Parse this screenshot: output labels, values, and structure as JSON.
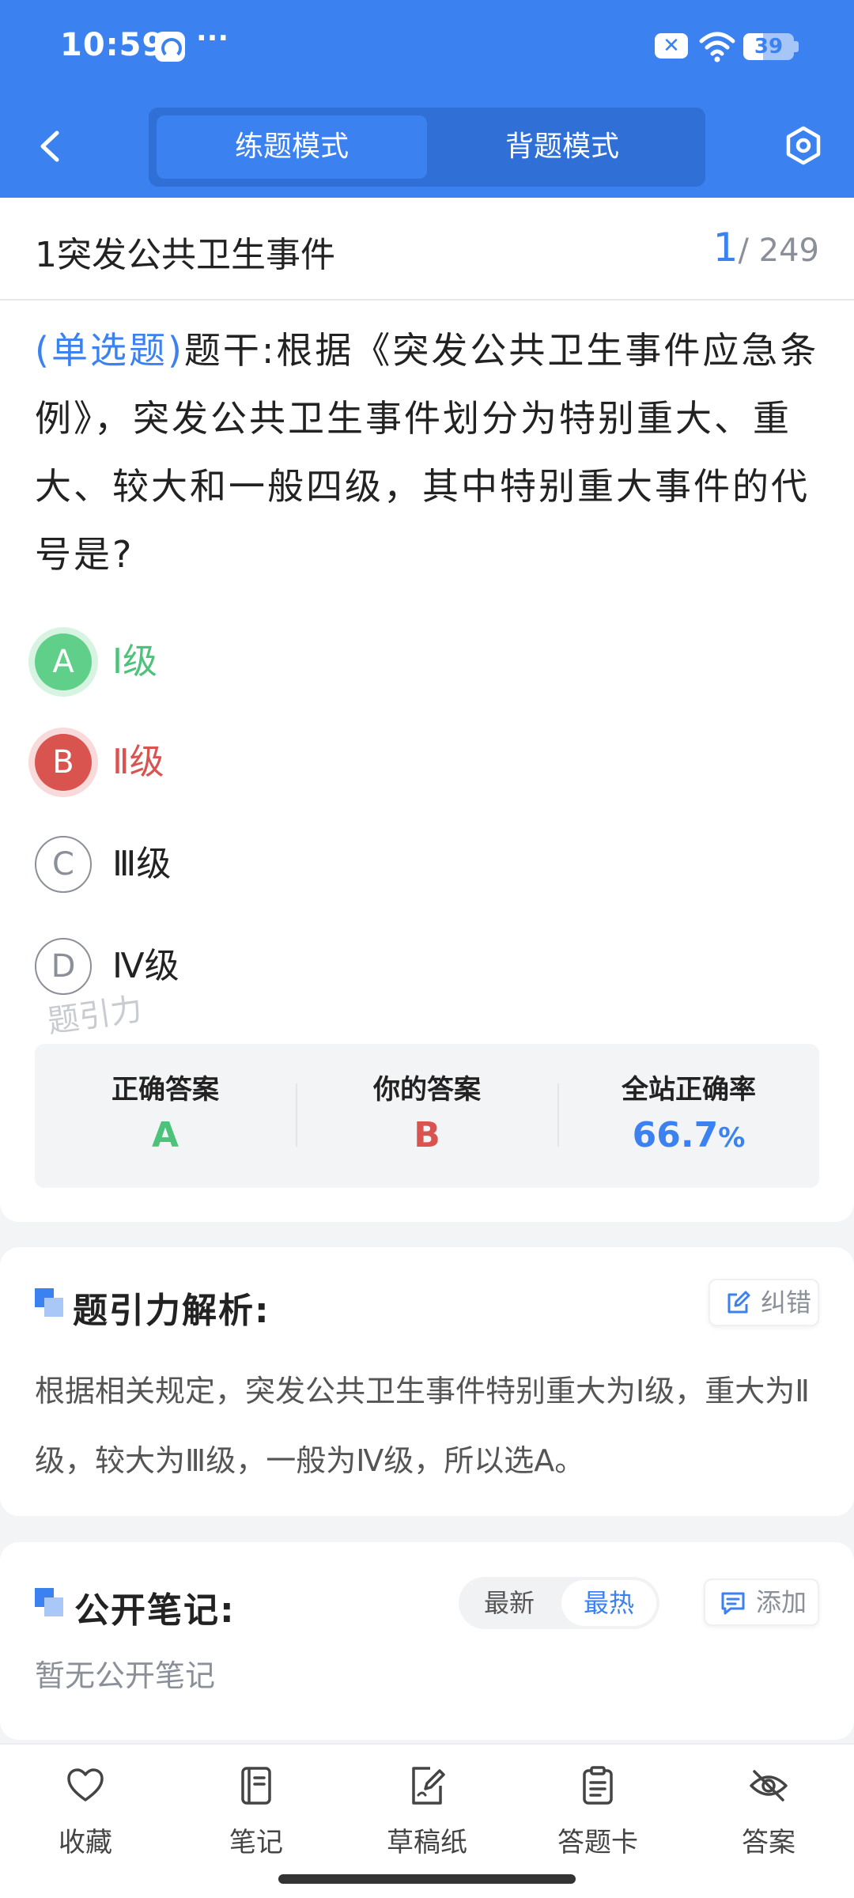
{
  "status_bar": {
    "time": "10:59",
    "more": "···",
    "x_badge": "✕",
    "battery": "39",
    "battery_level": 0.39
  },
  "header": {
    "mode_active": "练题模式",
    "mode_inactive": "背题模式"
  },
  "question_header": {
    "chapter_title": "1突发公共卫生事件",
    "current": "1",
    "total": "/ 249"
  },
  "question": {
    "type": "(单选题)",
    "stem": "题干:根据《突发公共卫生事件应急条例》，突发公共卫生事件划分为特别重大、重大、较大和一般四级，其中特别重大事件的代号是?"
  },
  "options": [
    {
      "letter": "A",
      "text": "Ⅰ级",
      "state": "correct"
    },
    {
      "letter": "B",
      "text": "Ⅱ级",
      "state": "wrong"
    },
    {
      "letter": "C",
      "text": "Ⅲ级",
      "state": "normal"
    },
    {
      "letter": "D",
      "text": "Ⅳ级",
      "state": "normal"
    }
  ],
  "watermark": "题引力",
  "result": {
    "correct_label": "正确答案",
    "correct_value": "A",
    "yours_label": "你的答案",
    "yours_value": "B",
    "rate_label": "全站正确率",
    "rate_value": "66.7",
    "rate_unit": "%"
  },
  "analysis": {
    "title": "题引力解析:",
    "report_label": "纠错",
    "text": "根据相关规定，突发公共卫生事件特别重大为Ⅰ级，重大为Ⅱ级，较大为Ⅲ级，一般为Ⅳ级，所以选A。"
  },
  "notes": {
    "title": "公开笔记:",
    "sort_newest": "最新",
    "sort_hottest": "最热",
    "add_label": "添加",
    "empty": "暂无公开笔记"
  },
  "bottom_bar": {
    "favorite": "收藏",
    "notes": "笔记",
    "scratch": "草稿纸",
    "answer_card": "答题卡",
    "answer": "答案"
  },
  "colors": {
    "primary": "#3b82f0",
    "correct": "#4cc27a",
    "wrong": "#d9534f"
  }
}
